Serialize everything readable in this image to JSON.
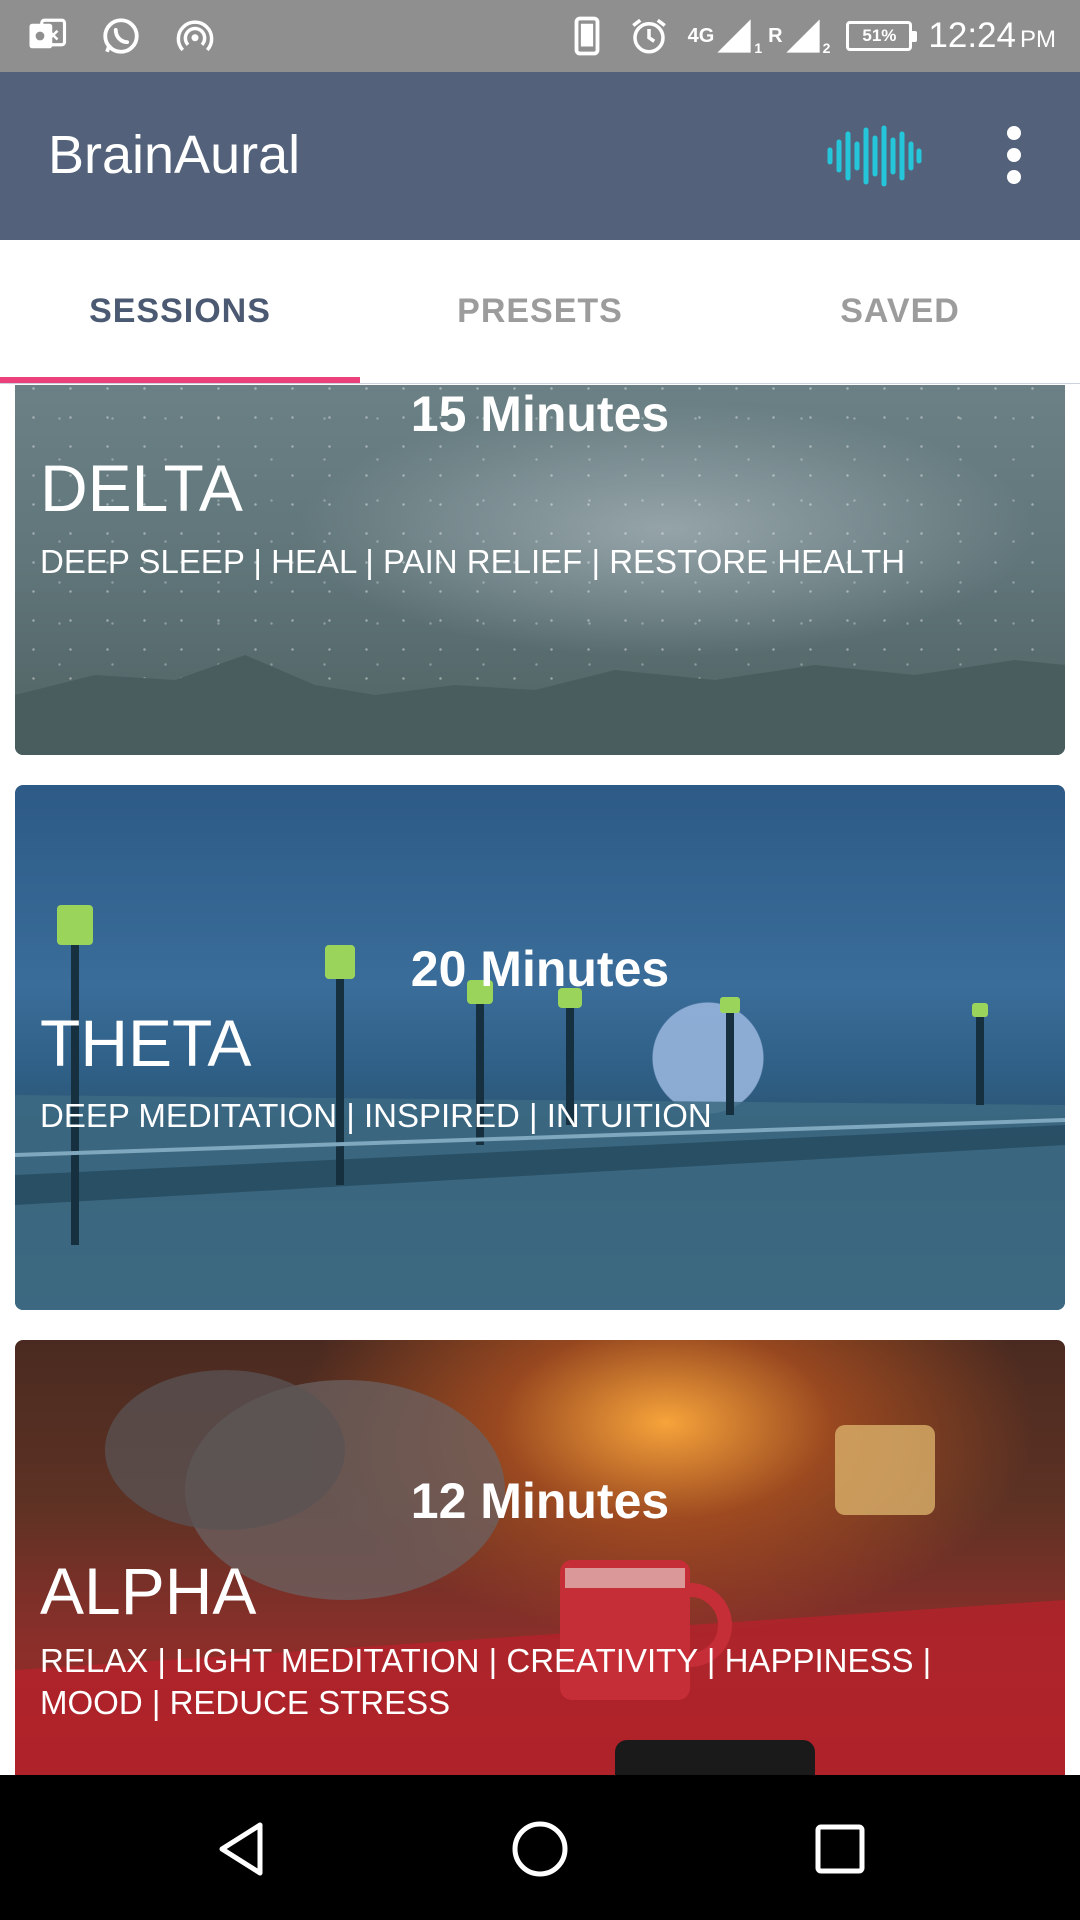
{
  "status_bar": {
    "network_label": "4G",
    "network_label2": "R",
    "sim1": "1",
    "sim2": "2",
    "battery": "51%",
    "time": "12:24",
    "ampm": "PM"
  },
  "app_bar": {
    "title": "BrainAural"
  },
  "tabs": [
    {
      "label": "SESSIONS",
      "active": true
    },
    {
      "label": "PRESETS",
      "active": false
    },
    {
      "label": "SAVED",
      "active": false
    }
  ],
  "sessions": [
    {
      "duration": "15 Minutes",
      "name": "DELTA",
      "tags": "DEEP SLEEP | HEAL | PAIN RELIEF | RESTORE HEALTH"
    },
    {
      "duration": "20 Minutes",
      "name": "THETA",
      "tags": "DEEP MEDITATION | INSPIRED | INTUITION"
    },
    {
      "duration": "12 Minutes",
      "name": "ALPHA",
      "tags": "RELAX | LIGHT MEDITATION | CREATIVITY | HAPPINESS | MOOD | REDUCE STRESS"
    }
  ],
  "colors": {
    "app_bar": "#53627a",
    "tab_indicator": "#ec407a",
    "wave_icon": "#26c6da",
    "status_bar": "#8f8f8f"
  },
  "icons": {
    "status_left": [
      "photo-icon",
      "whatsapp-icon",
      "hotspot-icon"
    ],
    "status_right": [
      "phone-vibrate-icon",
      "alarm-icon",
      "signal-icon",
      "battery-icon"
    ],
    "app_bar": [
      "sound-wave-icon",
      "more-vert-icon"
    ],
    "nav": [
      "back-icon",
      "home-icon",
      "recents-icon"
    ]
  }
}
